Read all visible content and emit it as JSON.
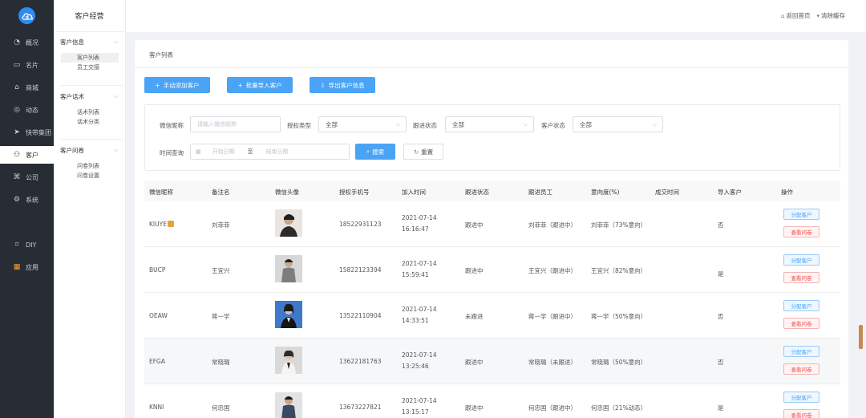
{
  "rail": {
    "items": [
      {
        "label": "概况",
        "icon": "pie-chart-icon"
      },
      {
        "label": "名片",
        "icon": "card-icon"
      },
      {
        "label": "商城",
        "icon": "shop-icon"
      },
      {
        "label": "动态",
        "icon": "compass-icon"
      },
      {
        "label": "快带集团",
        "icon": "rocket-icon"
      },
      {
        "label": "客户",
        "icon": "user-icon"
      },
      {
        "label": "公司",
        "icon": "company-icon"
      },
      {
        "label": "系统",
        "icon": "gear-icon"
      },
      {
        "label": "DIY",
        "icon": "diy-icon"
      },
      {
        "label": "应用",
        "icon": "apps-icon"
      }
    ]
  },
  "sidebar": {
    "title": "客户经营",
    "groups": [
      {
        "title": "客户信息",
        "items": [
          "客户列表",
          "员工交接"
        ]
      },
      {
        "title": "客户话术",
        "items": [
          "话术列表",
          "话术分类"
        ]
      },
      {
        "title": "客户问卷",
        "items": [
          "问卷列表",
          "问卷设置"
        ]
      }
    ]
  },
  "topbar": {
    "home_label": "返回首页",
    "clear_label": "清除缓存"
  },
  "page": {
    "title": "客户列表",
    "actions": {
      "add": "手动添加客户",
      "import": "批量导入客户",
      "export": "导出客户信息"
    }
  },
  "filters": {
    "wechat_label": "微信昵称",
    "wechat_placeholder": "请输入微信昵称",
    "auth_label": "授权类型",
    "auth_value": "全部",
    "follow_label": "跟进状态",
    "follow_value": "全部",
    "customer_label": "客户状态",
    "customer_value": "全部",
    "time_label": "时间查询",
    "start_placeholder": "开始日期",
    "to_label": "至",
    "end_placeholder": "结束日期",
    "search_label": "搜索",
    "reset_label": "重置"
  },
  "table": {
    "columns": [
      "微信昵称",
      "备注名",
      "微信头像",
      "授权手机号",
      "加入时间",
      "跟进状态",
      "跟进员工",
      "意向度(%)",
      "成交时间",
      "导入客户",
      "操作"
    ],
    "rows": [
      {
        "nick": "KIUYE",
        "remark": "刘菲菲",
        "phone": "18522931123",
        "date": "2021-07-14",
        "time": "16:16:47",
        "status": "跟进中",
        "staff": "刘菲菲（跟进中）",
        "intent": "刘菲菲（73%意向）",
        "deal": "",
        "imported": "否"
      },
      {
        "nick": "BUCP",
        "remark": "王宜兴",
        "phone": "15822123394",
        "date": "2021-07-14",
        "time": "15:59:41",
        "status": "跟进中",
        "staff": "王宜兴（跟进中）",
        "intent": "王宜兴（82%意向）",
        "deal": "",
        "imported": "是"
      },
      {
        "nick": "OEAW",
        "remark": "蒋一学",
        "phone": "13522110904",
        "date": "2021-07-14",
        "time": "14:33:51",
        "status": "未跟进",
        "staff": "蒋一学（跟进中）",
        "intent": "蒋一学（50%意向）",
        "deal": "",
        "imported": "否"
      },
      {
        "nick": "EFGA",
        "remark": "常晓璐",
        "phone": "13622181763",
        "date": "2021-07-14",
        "time": "13:25:46",
        "status": "跟进中",
        "staff": "常晓璐（未跟进）",
        "intent": "常晓璐（50%意向）",
        "deal": "",
        "imported": "否"
      },
      {
        "nick": "KNNI",
        "remark": "何忠国",
        "phone": "13673227821",
        "date": "2021-07-14",
        "time": "13:15:17",
        "status": "跟进中",
        "staff": "何忠国（跟进中）",
        "intent": "何忠国（21%动态）",
        "deal": "",
        "imported": "是"
      }
    ],
    "assign_label": "分配客户",
    "view_label": "查看问卷"
  }
}
